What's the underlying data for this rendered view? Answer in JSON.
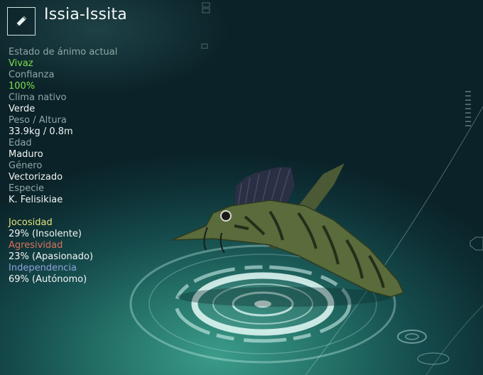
{
  "creature": {
    "name": "Issia-Issita"
  },
  "stats": [
    {
      "label": "Estado de ánimo actual",
      "value": "Vivaz",
      "highlight": true
    },
    {
      "label": "Confianza",
      "value": "100%",
      "highlight": true
    },
    {
      "label": "Clima nativo",
      "value": "Verde",
      "highlight": false
    },
    {
      "label": "Peso / Altura",
      "value": "33.9kg / 0.8m",
      "highlight": false
    },
    {
      "label": "Edad",
      "value": "Maduro",
      "highlight": false
    },
    {
      "label": "Género",
      "value": "Vectorizado",
      "highlight": false
    },
    {
      "label": "Especie",
      "value": "K. Felisikiae",
      "highlight": false
    }
  ],
  "traits": [
    {
      "label": "Jocosidad",
      "value": "29% (Insolente)",
      "color": "#e3e27a"
    },
    {
      "label": "Agresividad",
      "value": "23% (Apasionado)",
      "color": "#d9705a"
    },
    {
      "label": "Independencia",
      "value": "69% (Autónomo)",
      "color": "#8fa4dc"
    }
  ],
  "colors": {
    "highlight_value": "#7ee04a",
    "label": "#8fa8a6",
    "value": "#f3f5f4"
  },
  "icons": {
    "edit_button": "pencil-icon"
  }
}
